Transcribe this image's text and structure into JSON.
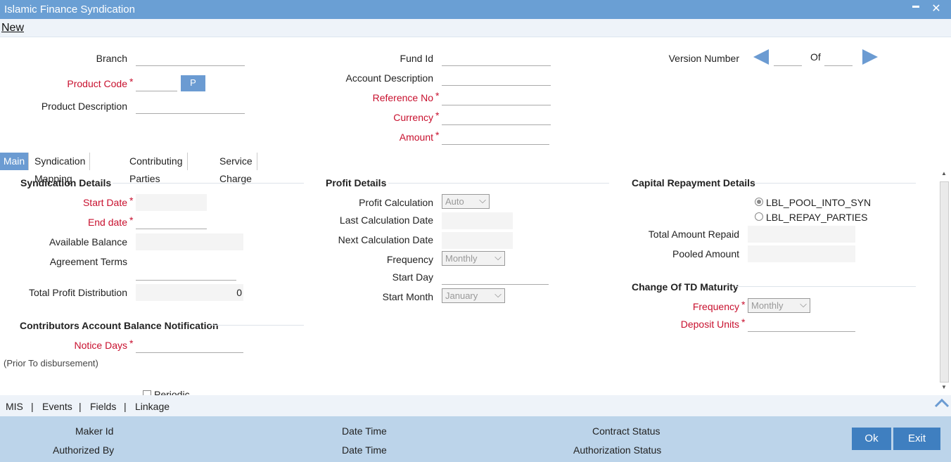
{
  "window": {
    "title": "Islamic Finance Syndication",
    "minimize": "▬",
    "close": "✕"
  },
  "menu": {
    "new_label": "New"
  },
  "header": {
    "branch_label": "Branch",
    "product_code_label": "Product Code",
    "product_desc_label": "Product Description",
    "p_button": "P",
    "fund_id_label": "Fund Id",
    "account_desc_label": "Account Description",
    "reference_no_label": "Reference No",
    "currency_label": "Currency",
    "amount_label": "Amount",
    "version_label": "Version Number",
    "of_label": "Of",
    "star": "*"
  },
  "tabs": [
    "Main",
    "Syndication Mapping",
    "Contributing Parties",
    "Service Charge"
  ],
  "syndication": {
    "title": "Syndication Details",
    "start_date_label": "Start Date",
    "end_date_label": "End date",
    "available_balance_label": "Available Balance",
    "agreement_terms_label": "Agreement Terms",
    "total_profit_label": "Total Profit Distribution",
    "total_profit_value": "0"
  },
  "contributors": {
    "title": "Contributors Account Balance Notification",
    "notice_days_label": "Notice Days",
    "prior_note": "(Prior To disbursement)",
    "periodic_label": "Periodic"
  },
  "profit": {
    "title": "Profit Details",
    "calc_label": "Profit Calculation",
    "calc_value": "Auto",
    "last_calc_label": "Last Calculation Date",
    "next_calc_label": "Next Calculation Date",
    "frequency_label": "Frequency",
    "frequency_value": "Monthly",
    "start_day_label": "Start Day",
    "start_month_label": "Start Month",
    "start_month_value": "January"
  },
  "capital": {
    "title": "Capital Repayment Details",
    "radio1": "LBL_POOL_INTO_SYN",
    "radio2": "LBL_REPAY_PARTIES",
    "total_repaid_label": "Total Amount Repaid",
    "pooled_label": "Pooled Amount"
  },
  "td": {
    "title": "Change Of TD Maturity",
    "frequency_label": "Frequency",
    "frequency_value": "Monthly",
    "deposit_units_label": "Deposit Units"
  },
  "footlinks": [
    "MIS",
    "|",
    "Events",
    "|",
    "Fields",
    "|",
    "Linkage"
  ],
  "footer": {
    "maker_id": "Maker Id",
    "date_time1": "Date Time",
    "contract_status": "Contract Status",
    "authorized_by": "Authorized By",
    "date_time2": "Date Time",
    "auth_status": "Authorization Status",
    "ok": "Ok",
    "exit": "Exit"
  },
  "colors": {
    "accent": "#6b9bd2",
    "required": "#c8102e",
    "footer_bg": "#bcd4ea",
    "button": "#3f7fc0"
  }
}
